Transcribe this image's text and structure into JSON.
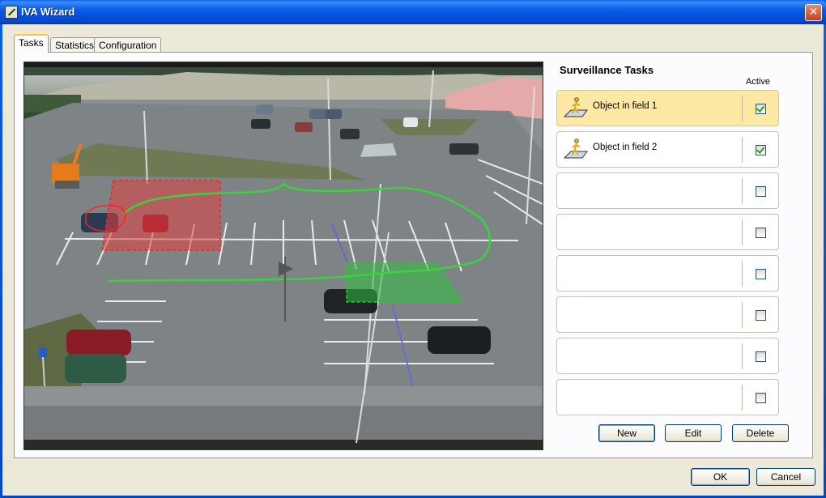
{
  "window": {
    "title": "IVA Wizard",
    "close_glyph": "✕"
  },
  "tabs": [
    {
      "label": "Tasks",
      "active": true
    },
    {
      "label": "Statistics",
      "active": false
    },
    {
      "label": "Configuration",
      "active": false
    }
  ],
  "tasks_panel": {
    "title": "Surveillance Tasks",
    "active_header": "Active",
    "rows": [
      {
        "label": "Object in field 1",
        "active": true,
        "selected": true,
        "icon": "person-in-field-icon"
      },
      {
        "label": "Object in field 2",
        "active": true,
        "selected": false,
        "icon": "person-in-field-icon"
      },
      {
        "label": "",
        "active": false,
        "selected": false,
        "icon": ""
      },
      {
        "label": "",
        "active": false,
        "selected": false,
        "icon": ""
      },
      {
        "label": "",
        "active": false,
        "selected": false,
        "icon": ""
      },
      {
        "label": "",
        "active": false,
        "selected": false,
        "icon": ""
      },
      {
        "label": "",
        "active": false,
        "selected": false,
        "icon": ""
      },
      {
        "label": "",
        "active": false,
        "selected": false,
        "icon": ""
      }
    ],
    "buttons": {
      "new": "New",
      "edit": "Edit",
      "delete": "Delete"
    }
  },
  "dialog_buttons": {
    "ok": "OK",
    "cancel": "Cancel"
  },
  "colors": {
    "selected_row": "#fde8a4",
    "field_1_overlay": "#e04040",
    "field_2_overlay": "#30c040",
    "trajectory": "#3cd23c",
    "title_bar": "#0a5ae6"
  }
}
